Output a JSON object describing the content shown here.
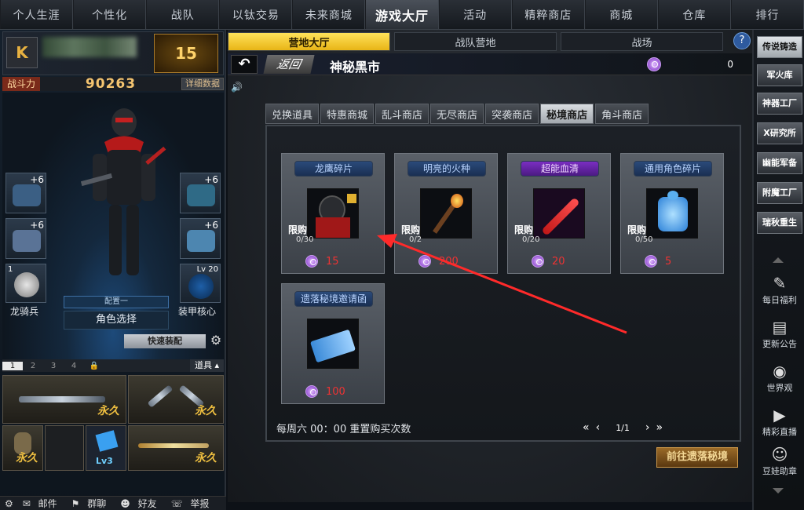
{
  "topnav": {
    "tabs": [
      "个人生涯",
      "个性化",
      "战队",
      "以钛交易",
      "未来商城",
      "游戏大厅",
      "活动",
      "精粹商店",
      "商城",
      "仓库",
      "排行"
    ],
    "active_index": 5
  },
  "profile": {
    "rank_level": "15",
    "power_label": "战斗力",
    "power_value": "90263",
    "detail_label": "详细数据"
  },
  "character": {
    "slots": [
      {
        "name": "armor-slot",
        "plus": "+6"
      },
      {
        "name": "helmet-slot",
        "plus": "+6"
      },
      {
        "name": "glove-slot",
        "plus": "+6"
      },
      {
        "name": "boot-slot",
        "plus": "+6"
      },
      {
        "name": "pet-slot",
        "num": "1",
        "label": "龙骑兵"
      },
      {
        "name": "core-slot",
        "lvl": "Lv 20",
        "label": "装甲核心"
      }
    ],
    "config_label": "配置一",
    "role_select": "角色选择",
    "quick_equip": "快速装配"
  },
  "loadout": {
    "tabs": [
      "1",
      "2",
      "3",
      "4"
    ],
    "bag_label": "道具",
    "forever_label": "永久",
    "lv_label": "Lv3"
  },
  "bottombar": {
    "mail": "邮件",
    "group_chat": "群聊",
    "friends": "好友",
    "report": "举报"
  },
  "subtabs": [
    "营地大厅",
    "战队营地",
    "战场"
  ],
  "subtab_active": 0,
  "help": "?",
  "header": {
    "back_label": "返回",
    "title": "神秘黑市",
    "currency_value": "0"
  },
  "shoptabs": [
    "兑换道具",
    "特惠商城",
    "乱斗商店",
    "无尽商店",
    "突袭商店",
    "秘境商店",
    "角斗商店"
  ],
  "shoptab_active": 5,
  "cards": [
    {
      "name": "龙鹰碎片",
      "style": "blue",
      "limit": "限购",
      "limit_count": "0/30",
      "price": "15"
    },
    {
      "name": "明亮的火种",
      "style": "blue",
      "limit": "限购",
      "limit_count": "0/2",
      "price": "200"
    },
    {
      "name": "超能血清",
      "style": "purple",
      "limit": "限购",
      "limit_count": "0/20",
      "price": "20"
    },
    {
      "name": "通用角色碎片",
      "style": "blue",
      "limit": "限购",
      "limit_count": "0/50",
      "price": "5"
    },
    {
      "name": "遗落秘境邀请函",
      "style": "blue",
      "limit": "",
      "limit_count": "",
      "price": "100"
    }
  ],
  "footer": {
    "reset_note": "每周六 00：00 重置购买次数",
    "page_info": "1/1",
    "go_button": "前往遗落秘境"
  },
  "sidebar": {
    "buttons": [
      "传说铸造",
      "军火库",
      "神器工厂",
      "X研究所",
      "幽能军备",
      "附魔工厂",
      "瑞秋重生"
    ],
    "active_index": 0,
    "icons": [
      {
        "label": "每日福利",
        "icon": "daily-reward-icon"
      },
      {
        "label": "更新公告",
        "icon": "announcement-icon"
      },
      {
        "label": "世界观",
        "icon": "globe-icon"
      },
      {
        "label": "精彩直播",
        "icon": "live-camera-icon"
      },
      {
        "label": "豆娃助章",
        "icon": "doll-icon"
      }
    ]
  },
  "colors": {
    "accent_yellow": "#f0c030",
    "price_red": "#e33333",
    "arrow_red": "#ff2a2a",
    "purple_coin": "#7a2ec2"
  }
}
